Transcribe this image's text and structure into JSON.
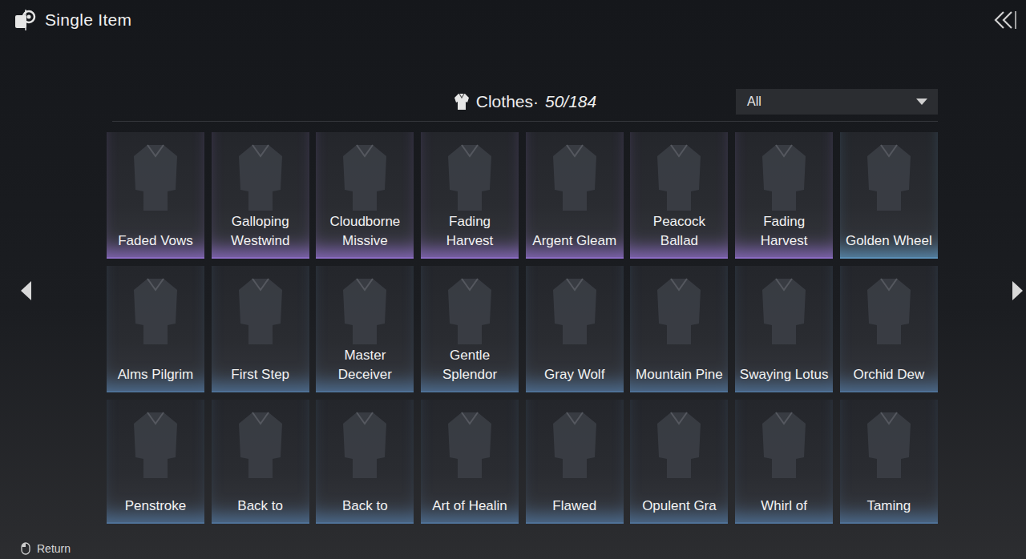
{
  "header": {
    "title": "Single Item"
  },
  "category": {
    "label": "Clothes",
    "separator": "·",
    "count": "50/184"
  },
  "filter": {
    "value": "All"
  },
  "items": [
    {
      "name": "Faded Vows",
      "color": "#8a6bc0"
    },
    {
      "name": "Galloping Westwind",
      "color": "#8a6bc0"
    },
    {
      "name": "Cloudborne Missive",
      "color": "#8a6bc0"
    },
    {
      "name": "Fading Harvest",
      "color": "#8a6bc0"
    },
    {
      "name": "Argent Gleam",
      "color": "#8a6bc0"
    },
    {
      "name": "Peacock Ballad",
      "color": "#8a6bc0"
    },
    {
      "name": "Fading Harvest",
      "color": "#8a6bc0"
    },
    {
      "name": "Golden Wheel",
      "color": "#5b8fb5"
    },
    {
      "name": "Alms Pilgrim",
      "color": "#4f7196"
    },
    {
      "name": "First Step",
      "color": "#4f7196"
    },
    {
      "name": "Master Deceiver",
      "color": "#4f7196"
    },
    {
      "name": "Gentle Splendor",
      "color": "#4f7196"
    },
    {
      "name": "Gray Wolf",
      "color": "#4f7196"
    },
    {
      "name": "Mountain Pine",
      "color": "#4f7196"
    },
    {
      "name": "Swaying Lotus",
      "color": "#4f7196"
    },
    {
      "name": "Orchid Dew",
      "color": "#4f7196"
    },
    {
      "name": "Penstroke",
      "color": "#4f7196"
    },
    {
      "name": "Back to",
      "color": "#4f7196"
    },
    {
      "name": "Back to",
      "color": "#4f7196"
    },
    {
      "name": "Art of Healin",
      "color": "#4f7196"
    },
    {
      "name": "Flawed",
      "color": "#4f7196"
    },
    {
      "name": "Opulent Gra",
      "color": "#4f7196"
    },
    {
      "name": "Whirl of",
      "color": "#4f7196"
    },
    {
      "name": "Taming",
      "color": "#4f7196"
    }
  ],
  "footer": {
    "return_label": "Return"
  }
}
